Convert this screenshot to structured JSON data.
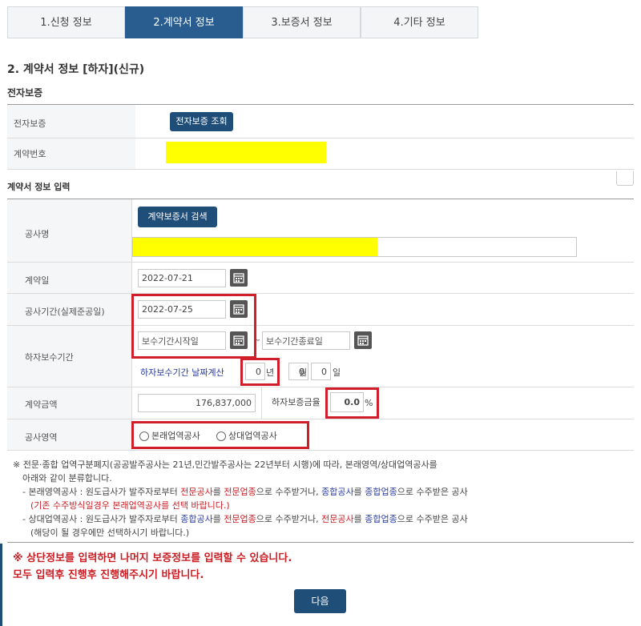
{
  "tabs": [
    {
      "label": "1.신청 정보",
      "active": false
    },
    {
      "label": "2.계약서 정보",
      "active": true
    },
    {
      "label": "3.보증서 정보",
      "active": false
    },
    {
      "label": "4.기타 정보",
      "active": false
    }
  ],
  "page_title": "2. 계약서 정보 [하자](신규)",
  "electronic_section": {
    "title": "전자보증",
    "row1_label": "전자보증",
    "lookup_button": "전자보증 조회",
    "row2_label": "계약번호"
  },
  "contract_section": {
    "title": "계약서 정보 입력",
    "project_name_label": "공사명",
    "search_button": "계약보증서 검색",
    "contract_date_label": "계약일",
    "contract_date": "2022-07-21",
    "period_label": "공사기간(실제준공일)",
    "completion_date": "2022-07-25",
    "warranty_label": "하자보수기간",
    "warranty_start_placeholder": "보수기간시작일",
    "range_sep": "~",
    "warranty_end_placeholder": "보수기간종료일",
    "calc_link": "하자보수기간 날짜계산",
    "years": "0",
    "years_unit": "년",
    "months": "0",
    "months_unit": "월",
    "days": "0",
    "days_unit": "일",
    "amount_label": "계약금액",
    "amount": "176,837,000",
    "rate_label": "하자보증금율",
    "rate": "0.0",
    "rate_unit": "%",
    "area_label": "공사영역",
    "radio1": "본래업역공사",
    "radio2": "상대업역공사"
  },
  "notes": {
    "line1": "※ 전문·종합 업역구분폐지(공공발주공사는 21년,민간발주공사는 22년부터 시행)에 따라, 본래영역/상대업역공사를",
    "line2": "아래와 같이 분류합니다.",
    "line3_a": "- 본래영역공사 : 원도급사가 발주자로부터 ",
    "line3_b": "전문공사",
    "line3_c": "를 ",
    "line3_d": "전문업종",
    "line3_e": "으로 수주받거나, ",
    "line3_f": "종합공사",
    "line3_g": "를 ",
    "line3_h": "종합업종",
    "line3_i": "으로 수주받은 공사",
    "line4": "(기존 수주방식일경우 본래업역공사를 선택 바랍니다.)",
    "line5_a": "- 상대업역공사 : 원도급사가 발주자로부터 ",
    "line5_b": "종합공사",
    "line5_c": "를 ",
    "line5_d": "전문업종",
    "line5_e": "으로 수주받거나, ",
    "line5_f": "전문공사",
    "line5_g": "를 ",
    "line5_h": "종합업종",
    "line5_i": "으로 수주받은 공사",
    "line6": "(해당이 될 경우에만 선택하시기 바랍니다.)"
  },
  "warning": {
    "line1": "※ 상단정보를 입력하면 나머지 보증정보를 입력할 수 있습니다.",
    "line2": "모두 입력후 진행후 진행해주시기 바랍니다."
  },
  "next_button": "다음",
  "colors": {
    "navy": "#1f4e79",
    "tab_active": "#2a5d8f",
    "highlight_red": "#d01f2a",
    "redacted": "#ffff00"
  }
}
